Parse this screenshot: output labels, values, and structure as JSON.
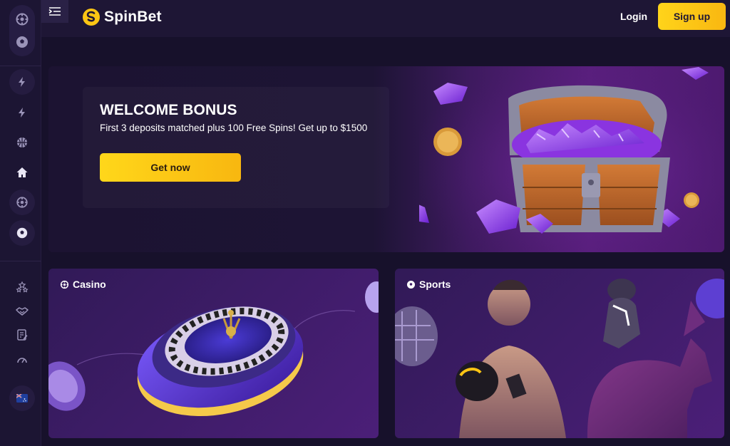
{
  "brand": {
    "name": "SpinBet",
    "accent": "#fcc514"
  },
  "header": {
    "login_label": "Login",
    "signup_label": "Sign up"
  },
  "sidebar": {
    "top_group": [
      "casino-chip-icon",
      "soccer-ball-icon"
    ],
    "nav": [
      "lightning-icon",
      "lightning-icon",
      "basketball-icon",
      "home-icon",
      "casino-chip-icon",
      "soccer-ball-icon"
    ],
    "bottom": [
      "stars-icon",
      "handshake-icon",
      "edit-document-icon",
      "speedometer-icon",
      "flag-icon"
    ]
  },
  "hero": {
    "title": "WELCOME BONUS",
    "subtitle": "First 3 deposits matched plus 100 Free Spins! Get up to $1500",
    "cta_label": "Get now"
  },
  "cards": {
    "casino": {
      "label": "Casino"
    },
    "sports": {
      "label": "Sports"
    }
  }
}
